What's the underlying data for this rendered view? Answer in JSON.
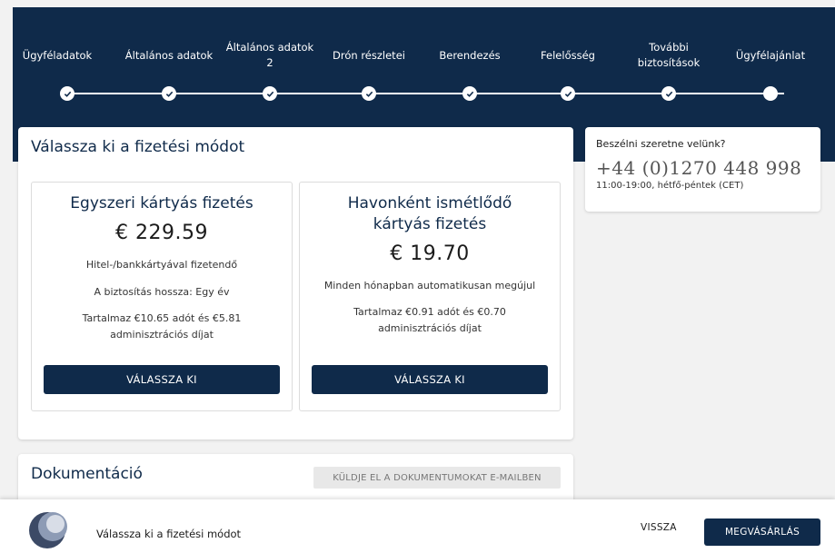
{
  "steps": [
    {
      "label": "Ügyféladatok"
    },
    {
      "label": "Általános adatok"
    },
    {
      "label": "Általános adatok",
      "label2": "2"
    },
    {
      "label": "Drón részletei"
    },
    {
      "label": "Berendezés"
    },
    {
      "label": "Felelősség"
    },
    {
      "label": "További",
      "label2": "biztosítások"
    },
    {
      "label": "Ügyfélajánlat"
    }
  ],
  "payment": {
    "title": "Válassza ki a fizetési módot",
    "options": [
      {
        "title": "Egyszeri kártyás fizetés",
        "price": "€ 229.59",
        "desc1": "Hitel-/bankkártyával fizetendő",
        "desc2": "A biztosítás hossza: Egy év",
        "desc3": "Tartalmaz €10.65 adót és €5.81 adminisztrációs díjat",
        "button": "VÁLASSZA KI"
      },
      {
        "title": "Havonként ismétlődő kártyás fizetés",
        "price": "€ 19.70",
        "desc1": "Minden hónapban automatikusan megújul",
        "desc2": "Tartalmaz €0.91 adót és €0.70 adminisztrációs díjat",
        "button": "VÁLASSZA KI"
      }
    ]
  },
  "contact": {
    "question": "Beszélni szeretne velünk?",
    "phone": "+44 (0)1270 448 998",
    "hours": "11:00-19:00, hétfő-péntek (CET)"
  },
  "documentation": {
    "title": "Dokumentáció",
    "email_button": "KÜLDJE EL A DOKUMENTUMOKAT E-MAILBEN"
  },
  "bottom": {
    "label": "Válassza ki a fizetési módot",
    "back": "VISSZA",
    "buy": "MEGVÁSÁRLÁS"
  },
  "colors": {
    "navy": "#0f2a4a",
    "white": "#ffffff"
  }
}
